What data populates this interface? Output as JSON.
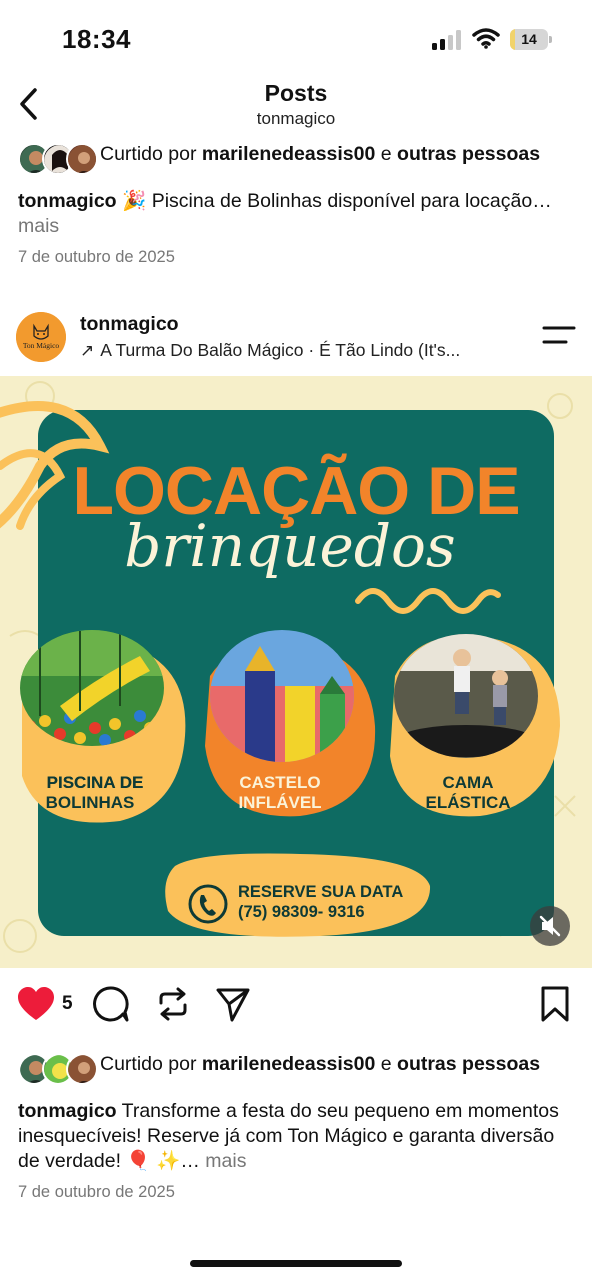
{
  "status_bar": {
    "time": "18:34",
    "battery": "14"
  },
  "nav": {
    "title": "Posts",
    "subtitle": "tonmagico"
  },
  "post_previous": {
    "likes_prefix": "Curtido por ",
    "likes_user": "marilenedeassis00",
    "likes_mid": " e ",
    "likes_suffix": "outras pessoas",
    "caption_user": "tonmagico",
    "caption_text": " 🎉 Piscina de Bolinhas disponível para locação…",
    "more": " mais",
    "date": "7 de outubro de 2025"
  },
  "post": {
    "username": "tonmagico",
    "avatar_text": "Ton Mágico",
    "music": "A Turma Do Balão Mágico · É Tão Lindo (It's...",
    "image": {
      "title_line1": "LOCAÇÃO DE",
      "title_line2": "brinquedos",
      "items": [
        {
          "label_1": "PISCINA DE",
          "label_2": "BOLINHAS"
        },
        {
          "label_1": "CASTELO",
          "label_2": "INFLÁVEL"
        },
        {
          "label_1": "CAMA",
          "label_2": "ELÁSTICA"
        }
      ],
      "cta_line1": "RESERVE SUA DATA",
      "cta_line2": "(75) 98309- 9316"
    },
    "like_count": "5",
    "likes_prefix": "Curtido por ",
    "likes_user": "marilenedeassis00",
    "likes_mid": " e ",
    "likes_suffix": "outras pessoas",
    "caption_user": "tonmagico",
    "caption_text": " Transforme a festa do seu pequeno em momentos inesquecíveis! Reserve já com Ton Mágico e garanta diversão de verdade! 🎈 ✨…",
    "more": " mais",
    "date": "7 de outubro de 2025"
  },
  "colors": {
    "teal": "#0e6b62",
    "orange": "#f2842a",
    "yellow": "#fbc15a",
    "cream": "#f6efc9",
    "like_red": "#ed1c3a"
  }
}
